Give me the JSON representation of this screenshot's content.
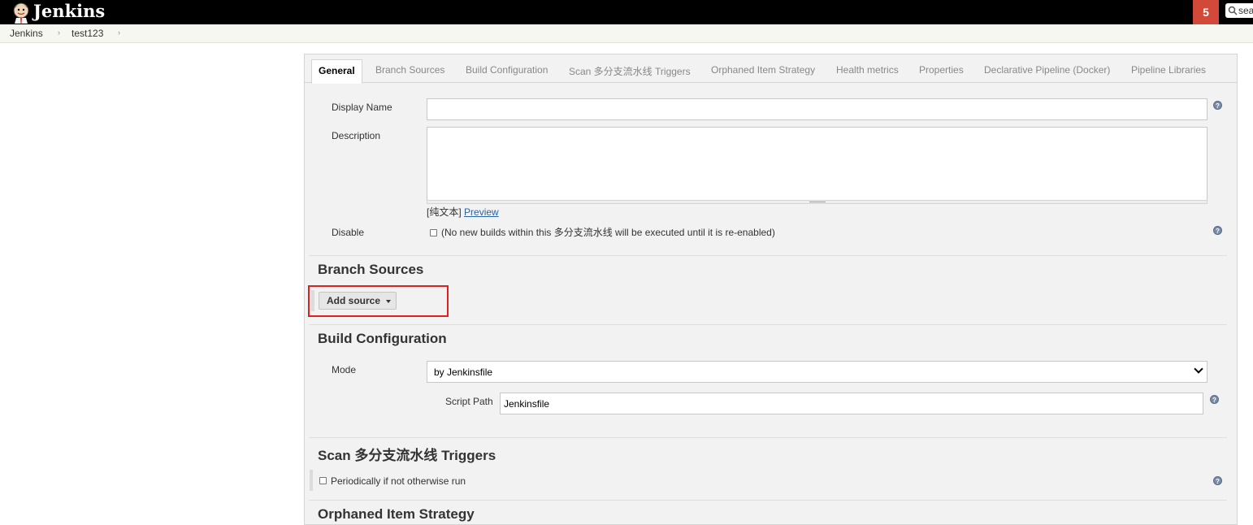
{
  "header": {
    "brand": "Jenkins",
    "notification_count": "5",
    "search_placeholder": "search"
  },
  "breadcrumb": {
    "items": [
      "Jenkins",
      "test123"
    ]
  },
  "tabs": [
    "General",
    "Branch Sources",
    "Build Configuration",
    "Scan 多分支流水线 Triggers",
    "Orphaned Item Strategy",
    "Health metrics",
    "Properties",
    "Declarative Pipeline (Docker)",
    "Pipeline Libraries"
  ],
  "general": {
    "display_name_label": "Display Name",
    "display_name_value": "",
    "description_label": "Description",
    "description_value": "",
    "format_text": "[纯文本]",
    "preview_link": "Preview",
    "disable_label": "Disable",
    "disable_text": "(No new builds within this 多分支流水线 will be executed until it is re-enabled)"
  },
  "branch_sources": {
    "title": "Branch Sources",
    "add_source_label": "Add source"
  },
  "build_configuration": {
    "title": "Build Configuration",
    "mode_label": "Mode",
    "mode_value": "by Jenkinsfile",
    "script_path_label": "Script Path",
    "script_path_value": "Jenkinsfile"
  },
  "scan_triggers": {
    "title": "Scan 多分支流水线 Triggers",
    "periodic_label": "Periodically if not otherwise run"
  },
  "orphaned": {
    "title": "Orphaned Item Strategy"
  },
  "colors": {
    "header_bg": "#000000",
    "badge": "#d24939",
    "highlight_box": "#e02020",
    "link": "#2a64a5"
  }
}
